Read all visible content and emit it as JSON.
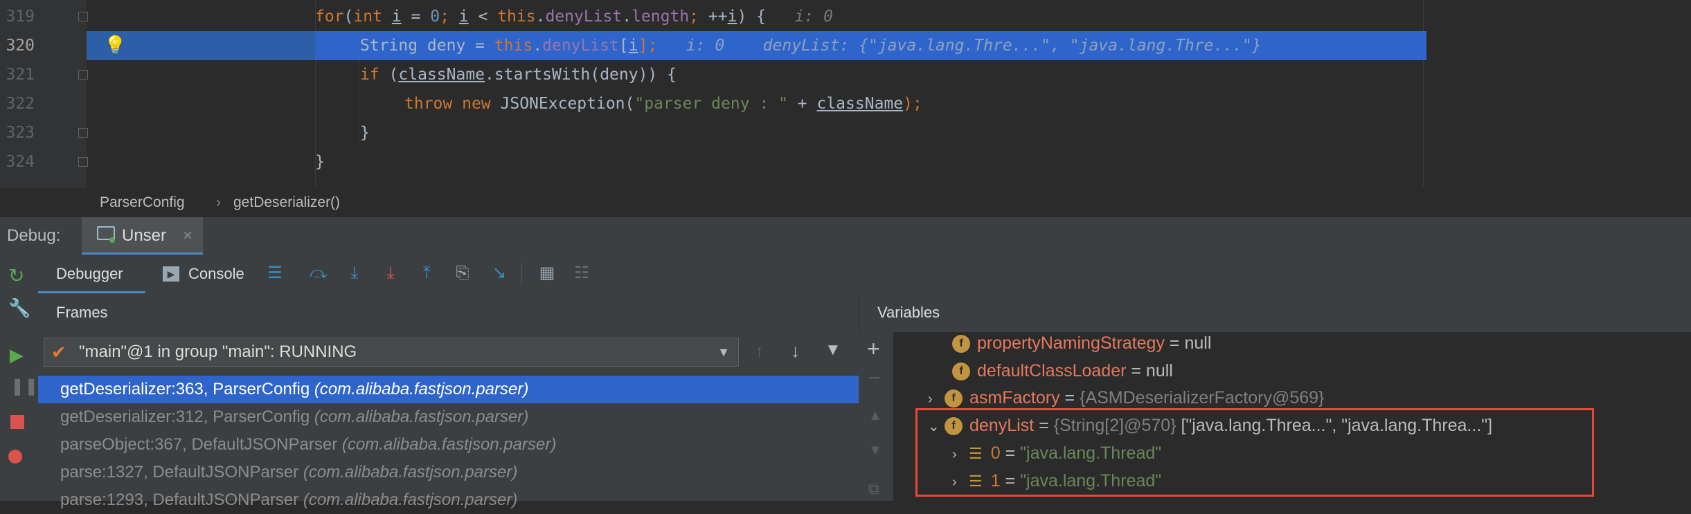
{
  "editor": {
    "line_numbers": [
      "319",
      "320",
      "321",
      "322",
      "323",
      "324"
    ],
    "line319": {
      "for": "for",
      "open": "(",
      "int": "int",
      "i1": "i",
      "eq": " = ",
      "zero": "0",
      "semi1": "; ",
      "i2": "i",
      "lt": " < ",
      "this": "this",
      "dot1": ".",
      "denyList": "denyList",
      "dot2": ".",
      "length": "length",
      "semi2": "; ",
      "inc": "++",
      "i3": "i",
      "close": ") {",
      "hint": "i: 0"
    },
    "line320": {
      "type": "String deny = ",
      "this": "this",
      "dot": ".",
      "denyList": "denyList",
      "idx_open": "[",
      "i": "i",
      "idx_close": "];",
      "hint1": "i: 0",
      "hint2": "denyList: {\"java.lang.Thre...\", \"java.lang.Thre...\"}"
    },
    "line321": {
      "if": "if",
      "open": " (",
      "className": "className",
      "rest": ".startsWith(deny)) {"
    },
    "line322": {
      "throw": "throw",
      "new": "new",
      "exc": " JSONException(",
      "str": "\"parser deny : \"",
      "plus": " + ",
      "className": "className",
      "end": ");"
    },
    "line323": {
      "text": "}"
    },
    "line324": {
      "text": "}"
    }
  },
  "breadcrumb": {
    "class": "ParserConfig",
    "sep": "›",
    "method": "getDeserializer()"
  },
  "debug": {
    "label": "Debug:",
    "tab": "Unser",
    "tab_close": "×"
  },
  "toolbar": {
    "debugger_tab": "Debugger",
    "console_tab": "Console"
  },
  "frames": {
    "header": "Frames",
    "thread": "\"main\"@1 in group \"main\": RUNNING",
    "items": [
      {
        "method": "getDeserializer:363, ParserConfig ",
        "pkg": "(com.alibaba.fastjson.parser)"
      },
      {
        "method": "getDeserializer:312, ParserConfig ",
        "pkg": "(com.alibaba.fastjson.parser)"
      },
      {
        "method": "parseObject:367, DefaultJSONParser ",
        "pkg": "(com.alibaba.fastjson.parser)"
      },
      {
        "method": "parse:1327, DefaultJSONParser ",
        "pkg": "(com.alibaba.fastjson.parser)"
      },
      {
        "method": "parse:1293, DefaultJSONParser ",
        "pkg": "(com.alibaba.fastjson.parser)"
      }
    ]
  },
  "variables": {
    "header": "Variables",
    "rows": [
      {
        "name": "propertyNamingStrategy",
        "eq": " = ",
        "value": "null"
      },
      {
        "name": "defaultClassLoader",
        "eq": " = ",
        "value": "null"
      },
      {
        "name": "asmFactory",
        "eq": " = ",
        "type": "{ASMDeserializerFactory@569}"
      },
      {
        "name": "denyList",
        "eq": " = ",
        "type": "{String[2]@570}",
        "value": " [\"java.lang.Threa...\", \"java.lang.Threa...\"]"
      }
    ],
    "children": [
      {
        "index": "0",
        "eq": " = ",
        "value": "\"java.lang.Thread\""
      },
      {
        "index": "1",
        "eq": " = ",
        "value": "\"java.lang.Thread\""
      }
    ]
  },
  "colors": {
    "highlight_box": "#e8473a",
    "selection": "#2d5fa8",
    "frame_selected": "#2f65ca"
  }
}
